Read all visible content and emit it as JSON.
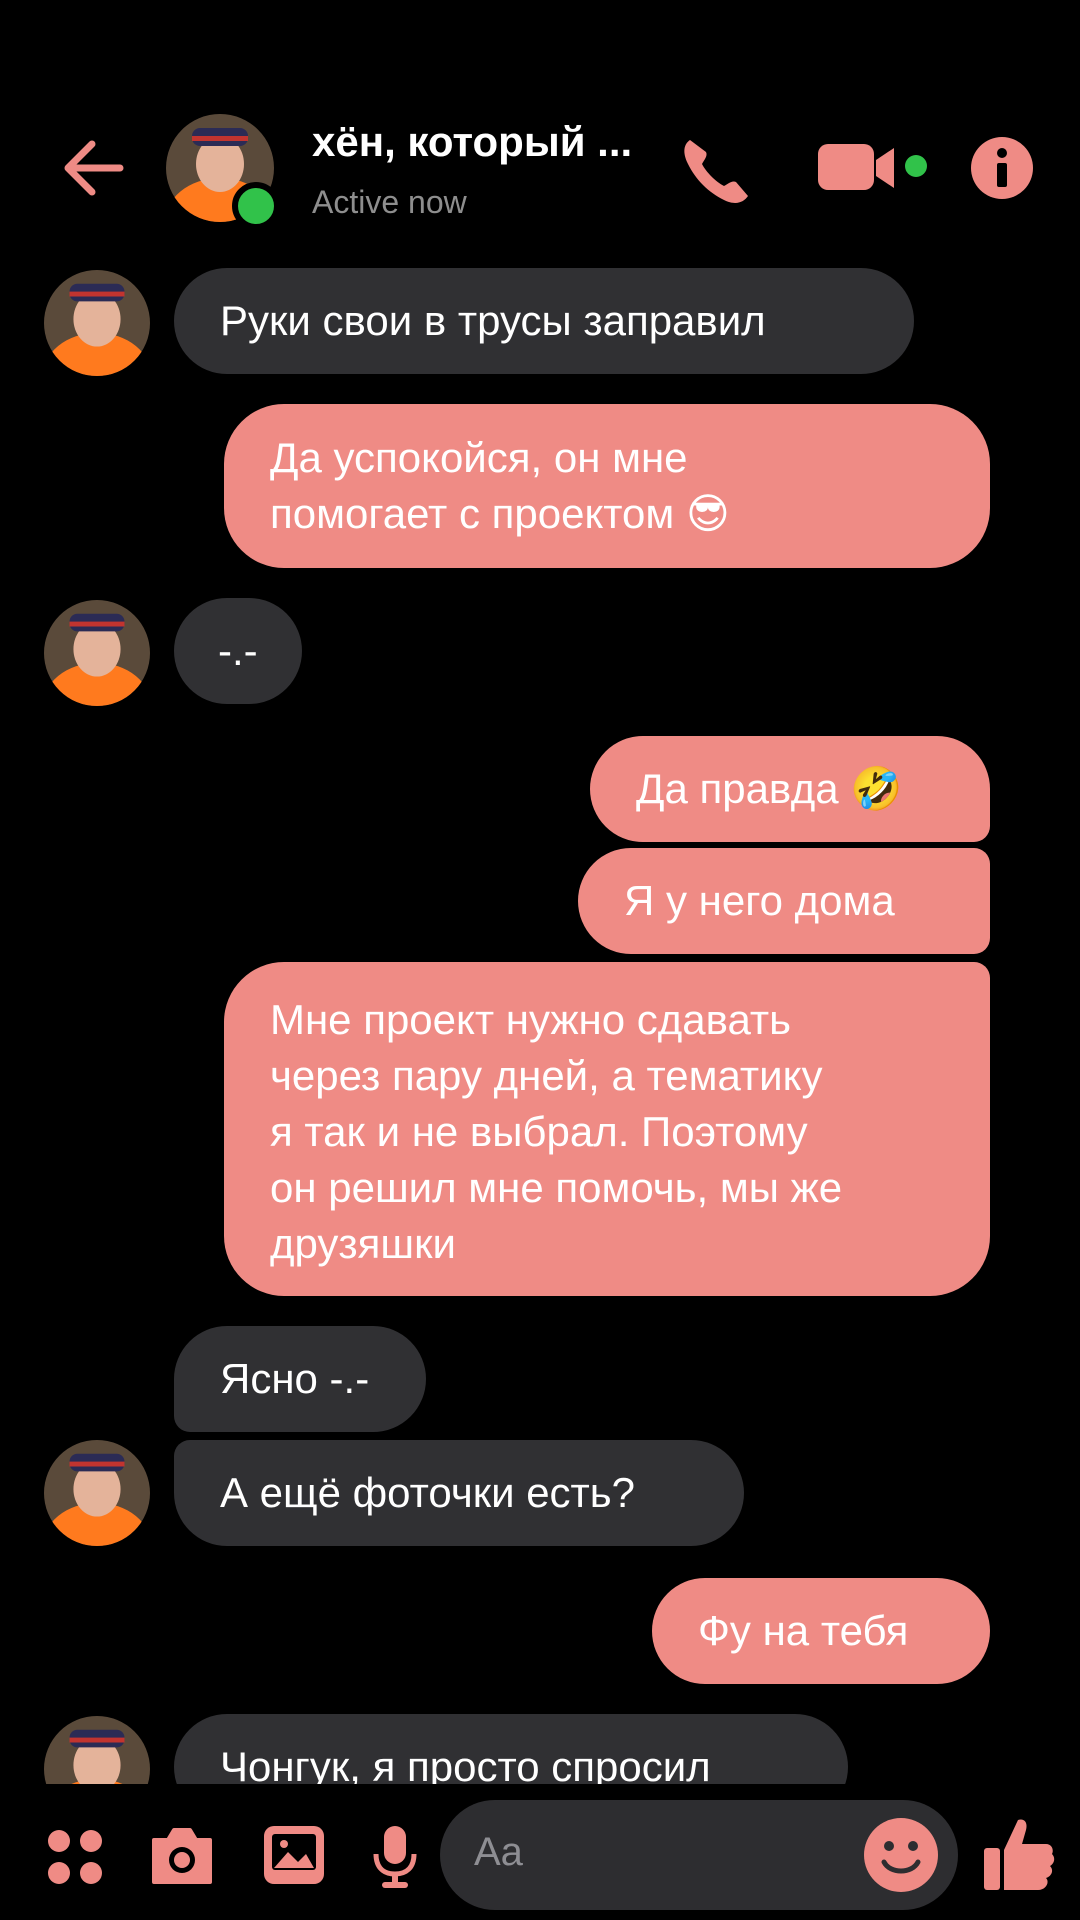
{
  "header": {
    "contact_name": "хён, который ...",
    "status": "Active now"
  },
  "messages": [
    {
      "side": "in",
      "text": "Руки свои в трусы заправил"
    },
    {
      "side": "out",
      "text": "Да успокойся, он мне\nпомогает с проектом 😎"
    },
    {
      "side": "in",
      "text": "-.-"
    },
    {
      "side": "out",
      "text": "Да правда 🤣"
    },
    {
      "side": "out",
      "text": "Я у него дома"
    },
    {
      "side": "out",
      "text": "Мне проект нужно сдавать\nчерез пару дней, а тематику\nя так и не выбрал. Поэтому\nон решил мне помочь, мы же\nдрузяшки"
    },
    {
      "side": "in",
      "text": "Ясно -.-"
    },
    {
      "side": "in",
      "text": "А ещё фоточки есть?"
    },
    {
      "side": "out",
      "text": "Фу на тебя"
    },
    {
      "side": "in",
      "text": "Чонгук, я просто спросил"
    }
  ],
  "composer": {
    "placeholder": "Aa"
  },
  "colors": {
    "accent": "#ef8b85",
    "incoming_bubble": "#303033",
    "online": "#31c24a"
  },
  "icons": [
    "back-arrow-icon",
    "phone-icon",
    "video-camera-icon",
    "info-icon",
    "apps-icon",
    "camera-icon",
    "gallery-icon",
    "microphone-icon",
    "emoji-icon",
    "thumbs-up-icon"
  ]
}
